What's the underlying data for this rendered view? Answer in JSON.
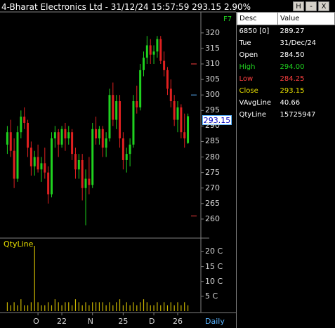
{
  "title": "4-Bharat Electronics Ltd - 31/12/24 15:57:59 293.15 2.90%",
  "shortcut_label": "F7",
  "window_buttons": [
    "H",
    "-",
    "X"
  ],
  "info_panel": {
    "header": {
      "desc": "Desc",
      "value": "Value"
    },
    "rows": [
      {
        "key": "6850 [0]",
        "value": "289.27",
        "color": "#ffffff"
      },
      {
        "key": "Tue",
        "value": "31/Dec/24",
        "color": "#ffffff"
      },
      {
        "key": "Open",
        "value": "284.50",
        "color": "#ffffff"
      },
      {
        "key": "High",
        "value": "294.00",
        "color": "#1fd11f"
      },
      {
        "key": "Low",
        "value": "284.25",
        "color": "#ff4040"
      },
      {
        "key": "Close",
        "value": "293.15",
        "color": "#e8e000"
      },
      {
        "key": "VAvgLine",
        "value": "40.66",
        "color": "#ffffff"
      },
      {
        "key": "QtyLine",
        "value": "15725947",
        "color": "#ffffff"
      }
    ]
  },
  "volume_panel_label": "QtyLine",
  "timeframe_label": "Daily",
  "current_price_label": "293.15",
  "colors": {
    "up": "#1fd11f",
    "down": "#e02020",
    "volume": "#c8b400",
    "axis": "#808080"
  },
  "chart_data": {
    "type": "candlestick",
    "price_axis": {
      "min": 255,
      "max": 322,
      "ticks": [
        "260",
        "265",
        "270",
        "275",
        "280",
        "285",
        "290",
        "295",
        "300",
        "305",
        "310",
        "315",
        "320"
      ]
    },
    "volume_axis": {
      "ticks": [
        "5 C",
        "10 C",
        "15 C",
        "20 C"
      ]
    },
    "x_tick_labels": [
      "O",
      "22",
      "N",
      "25",
      "D",
      "26"
    ],
    "candles": [
      [
        284,
        290,
        281,
        288
      ],
      [
        288,
        292,
        280,
        282
      ],
      [
        282,
        286,
        270,
        273
      ],
      [
        273,
        290,
        272,
        288
      ],
      [
        288,
        295,
        286,
        293
      ],
      [
        293,
        296,
        289,
        291
      ],
      [
        291,
        292,
        280,
        283
      ],
      [
        283,
        285,
        274,
        277
      ],
      [
        277,
        282,
        274,
        280
      ],
      [
        280,
        284,
        275,
        276
      ],
      [
        276,
        280,
        272,
        278
      ],
      [
        278,
        283,
        273,
        275
      ],
      [
        275,
        277,
        265,
        268
      ],
      [
        268,
        288,
        267,
        286
      ],
      [
        286,
        290,
        283,
        288
      ],
      [
        288,
        289,
        280,
        284
      ],
      [
        284,
        290,
        283,
        289
      ],
      [
        289,
        291,
        282,
        286
      ],
      [
        286,
        290,
        284,
        288
      ],
      [
        288,
        289,
        279,
        281
      ],
      [
        281,
        283,
        273,
        276
      ],
      [
        276,
        281,
        273,
        279
      ],
      [
        279,
        281,
        266,
        270
      ],
      [
        270,
        276,
        258,
        273
      ],
      [
        273,
        280,
        268,
        271
      ],
      [
        271,
        291,
        270,
        289
      ],
      [
        289,
        293,
        284,
        286
      ],
      [
        286,
        290,
        284,
        289
      ],
      [
        289,
        290,
        280,
        283
      ],
      [
        283,
        288,
        280,
        286
      ],
      [
        286,
        302,
        285,
        300
      ],
      [
        300,
        304,
        290,
        292
      ],
      [
        292,
        300,
        289,
        298
      ],
      [
        298,
        300,
        283,
        286
      ],
      [
        286,
        288,
        276,
        279
      ],
      [
        279,
        283,
        275,
        281
      ],
      [
        281,
        286,
        277,
        284
      ],
      [
        284,
        300,
        283,
        298
      ],
      [
        298,
        303,
        294,
        296
      ],
      [
        296,
        310,
        295,
        308
      ],
      [
        308,
        314,
        306,
        312
      ],
      [
        312,
        319,
        310,
        316
      ],
      [
        316,
        318,
        310,
        313
      ],
      [
        313,
        316,
        310,
        314
      ],
      [
        314,
        319,
        312,
        318
      ],
      [
        318,
        319,
        310,
        311
      ],
      [
        311,
        314,
        306,
        308
      ],
      [
        308,
        309,
        300,
        302
      ],
      [
        302,
        305,
        296,
        298
      ],
      [
        298,
        300,
        290,
        292
      ],
      [
        292,
        298,
        288,
        296
      ],
      [
        296,
        297,
        286,
        288
      ],
      [
        288,
        294,
        283,
        286
      ],
      [
        284.5,
        294,
        284.25,
        293.15
      ]
    ],
    "volumes": [
      3,
      2,
      3,
      2,
      4,
      2,
      2,
      3,
      22,
      3,
      2,
      2,
      3,
      2,
      4,
      3,
      2,
      3,
      3,
      2,
      4,
      3,
      2,
      3,
      2,
      3,
      3,
      3,
      3,
      2,
      3,
      2,
      3,
      4,
      2,
      3,
      2,
      3,
      2,
      3,
      4,
      3,
      2,
      2,
      3,
      2,
      3,
      2,
      3,
      2,
      3,
      2,
      3,
      2
    ]
  }
}
